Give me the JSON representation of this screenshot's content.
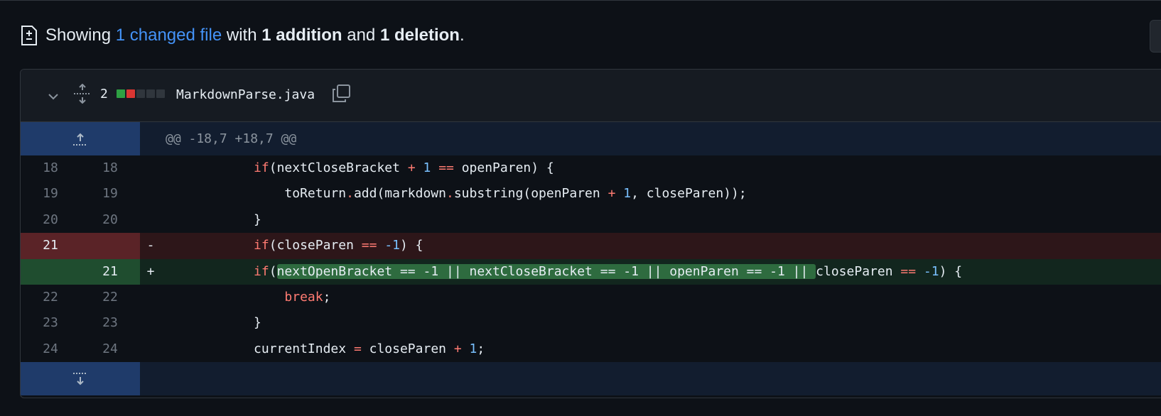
{
  "summary": {
    "showing": "Showing ",
    "changed_link": "1 changed file",
    "with": " with ",
    "additions": "1 addition",
    "and": " and ",
    "deletions": "1 deletion",
    "period": "."
  },
  "file": {
    "change_count": "2",
    "name": "MarkdownParse.java",
    "stat_blocks": [
      "add",
      "del",
      "neutral",
      "neutral",
      "neutral"
    ]
  },
  "hunk_header": "@@ -18,7 +18,7 @@",
  "lines": [
    {
      "old": "18",
      "new": "18",
      "sign": "",
      "type": "ctx"
    },
    {
      "old": "19",
      "new": "19",
      "sign": "",
      "type": "ctx"
    },
    {
      "old": "20",
      "new": "20",
      "sign": "",
      "type": "ctx"
    },
    {
      "old": "21",
      "new": "",
      "sign": "-",
      "type": "del"
    },
    {
      "old": "",
      "new": "21",
      "sign": "+",
      "type": "add"
    },
    {
      "old": "22",
      "new": "22",
      "sign": "",
      "type": "ctx"
    },
    {
      "old": "23",
      "new": "23",
      "sign": "",
      "type": "ctx"
    },
    {
      "old": "24",
      "new": "24",
      "sign": "",
      "type": "ctx"
    }
  ],
  "code": {
    "l18": {
      "indent": "            ",
      "kw_if": "if",
      "a": "(nextCloseBracket ",
      "plus": "+",
      "sp": " ",
      "one": "1",
      "sp2": " ",
      "eq": "==",
      "b": " openParen) {"
    },
    "l19": {
      "indent": "                ",
      "a": "toReturn",
      "dot": ".",
      "b": "add(markdown",
      "dot2": ".",
      "c": "substring(openParen ",
      "plus": "+",
      "sp": " ",
      "one": "1",
      "d": ", closeParen));"
    },
    "l20": {
      "indent": "            ",
      "a": "}"
    },
    "l21del": {
      "indent": "            ",
      "kw_if": "if",
      "a": "(closeParen ",
      "eq": "==",
      "sp": " ",
      "neg1": "-1",
      "b": ") {"
    },
    "l21add": {
      "indent": "            ",
      "kw_if": "if",
      "paren": "(",
      "hl": "nextOpenBracket == -1 || nextCloseBracket == -1 || openParen == -1 || ",
      "a": "closeParen ",
      "eq": "==",
      "sp": " ",
      "neg1": "-1",
      "b": ") {"
    },
    "l22": {
      "indent": "                ",
      "kw": "break",
      "a": ";"
    },
    "l23": {
      "indent": "            ",
      "a": "}"
    },
    "l24": {
      "indent": "            ",
      "a": "currentIndex ",
      "eq": "=",
      "b": " closeParen ",
      "plus": "+",
      "sp": " ",
      "one": "1",
      "c": ";"
    }
  },
  "colors": {
    "accent": "#4493f8",
    "addition": "#2ea043",
    "deletion": "#da3633",
    "keyword": "#ff7b72",
    "number": "#79c0ff"
  },
  "icons": [
    "file-diff-icon",
    "chevron-down-icon",
    "expand-all-icon",
    "copy-icon",
    "expand-up-icon",
    "expand-down-icon"
  ]
}
